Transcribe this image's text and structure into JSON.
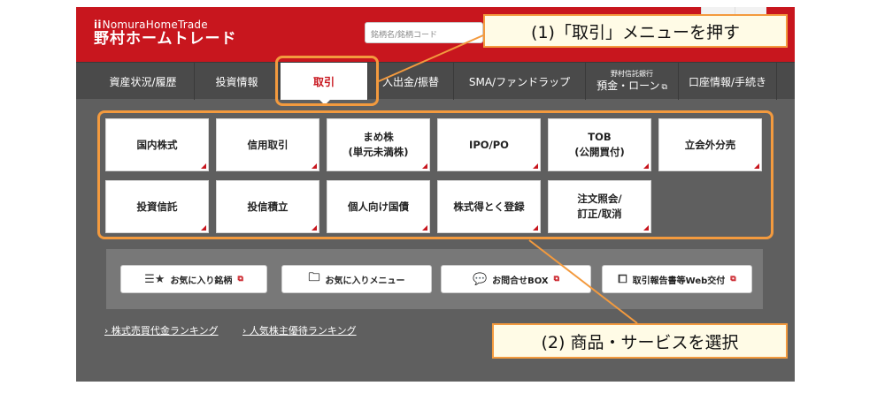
{
  "brand": {
    "name_en": "NomuraHomeTrade",
    "name_jp": "野村ホームトレード"
  },
  "search": {
    "placeholder": "銘柄名/銘柄コード"
  },
  "nav": {
    "items": [
      {
        "label": "資産状況/履歴"
      },
      {
        "label": "投資情報"
      },
      {
        "label": "取引"
      },
      {
        "label": "入出金/振替"
      },
      {
        "label": "SMA/ファンドラップ"
      },
      {
        "sub": "野村信託銀行",
        "label": "預金・ローン",
        "ext": "⧉"
      },
      {
        "label": "口座情報/手続き"
      }
    ]
  },
  "menu": {
    "row1": [
      {
        "label": "国内株式"
      },
      {
        "label": "信用取引"
      },
      {
        "label": "まめ株",
        "sub": "(単元未満株)"
      },
      {
        "label": "IPO/PO"
      },
      {
        "label": "TOB",
        "sub": "(公開買付)"
      },
      {
        "label": "立会外分売"
      }
    ],
    "row2": [
      {
        "label": "投資信託"
      },
      {
        "label": "投信積立"
      },
      {
        "label": "個人向け国債"
      },
      {
        "label": "株式得とく登録"
      },
      {
        "label": "注文照会/",
        "sub": "訂正/取消"
      }
    ]
  },
  "panel": {
    "buttons": [
      {
        "icon": "☰★",
        "label": "お気に入り銘柄",
        "ext": "⧉"
      },
      {
        "icon": "🗀",
        "label": "お気に入りメニュー",
        "ext": ""
      },
      {
        "icon": "💬",
        "label": "お問合せBOX",
        "ext": "⧉"
      },
      {
        "icon": "⧠",
        "label": "取引報告書等Web交付",
        "ext": "⧉"
      }
    ]
  },
  "rankings": [
    {
      "label": "› 株式売買代金ランキング"
    },
    {
      "label": "› 人気株主優待ランキング"
    }
  ],
  "annotations": {
    "callout1": "(1)「取引」メニューを押す",
    "callout2": "(2) 商品・サービスを選択"
  },
  "colors": {
    "brand_red": "#c8161e",
    "highlight": "#f39a3e"
  }
}
